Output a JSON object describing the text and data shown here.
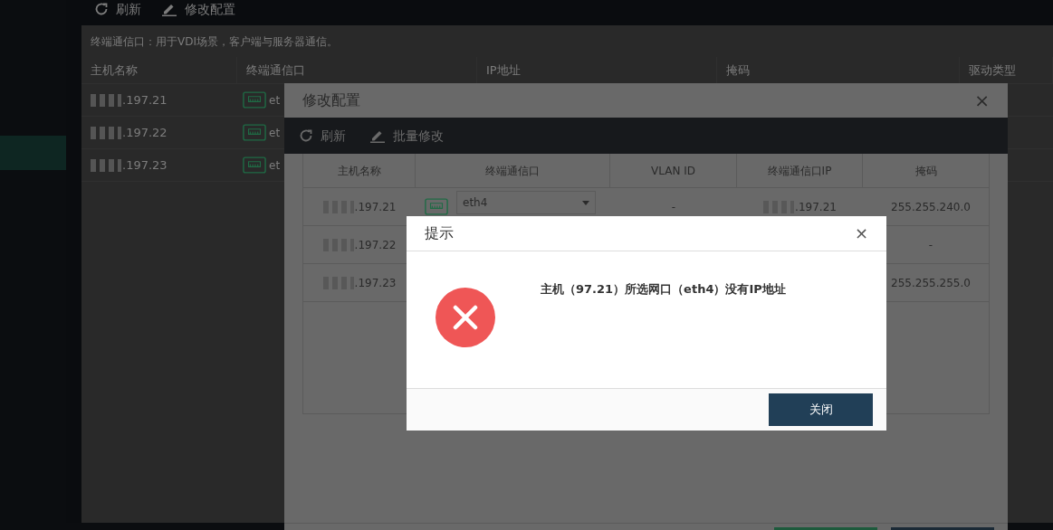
{
  "sidebar": {
    "items": [
      {
        "selected": true
      }
    ]
  },
  "toolbar": [
    {
      "kind": "refresh",
      "label": "刷新"
    },
    {
      "kind": "edit",
      "label": "修改配置"
    }
  ],
  "note": "终端通信口：用于VDI场景，客户端与服务器通信。",
  "table": {
    "columns": [
      "主机名称",
      "终端通信口",
      "IP地址",
      "掩码",
      "驱动类型"
    ],
    "rows": [
      {
        "host": ".197.21",
        "port": "et"
      },
      {
        "host": ".197.22",
        "port": "et"
      },
      {
        "host": ".197.23",
        "port": "et"
      }
    ]
  },
  "modal": {
    "title": "修改配置",
    "close": "×",
    "toolbar": [
      {
        "kind": "refresh",
        "label": "刷新"
      },
      {
        "kind": "edit",
        "label": "批量修改"
      }
    ],
    "table": {
      "columns": [
        "主机名称",
        "终端通信口",
        "VLAN ID",
        "终端通信口IP",
        "掩码"
      ],
      "rows": [
        {
          "host": ".197.21",
          "port": "eth4",
          "vlan": "-",
          "ip": ".197.21",
          "mask": "255.255.240.0"
        },
        {
          "host": ".197.22",
          "mask": "-"
        },
        {
          "host": ".197.23",
          "mask": "255.255.255.0"
        }
      ]
    },
    "footer_buttons": [
      {
        "kind": "primary"
      },
      {
        "kind": "dark"
      }
    ]
  },
  "dialog": {
    "title": "提示",
    "close": "×",
    "kind": "error",
    "message": "主机（97.21）所选网口（eth4）没有IP地址",
    "button": "关闭"
  }
}
